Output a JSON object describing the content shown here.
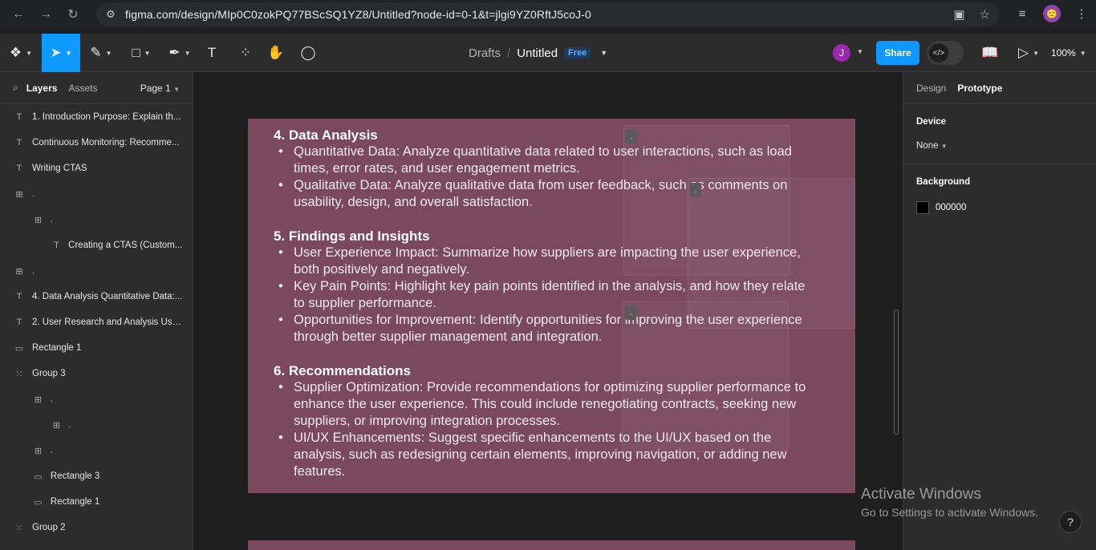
{
  "browser": {
    "url": "figma.com/design/MIp0C0zokPQ77BScSQ1YZ8/Untitled?node-id=0-1&t=jlgi9YZ0RftJ5coJ-0",
    "profile_initial": "🙂"
  },
  "toolbar": {
    "breadcrumb": "Drafts",
    "file_name": "Untitled",
    "plan_badge": "Free",
    "user_initial": "J",
    "share_label": "Share",
    "zoom": "100%"
  },
  "left_panel": {
    "tab_layers": "Layers",
    "tab_assets": "Assets",
    "page": "Page 1",
    "layers": [
      {
        "icon": "T",
        "label": "1. Introduction Purpose: Explain th...",
        "indent": 0,
        "bold": false
      },
      {
        "icon": "T",
        "label": "Continuous Monitoring: Recomme...",
        "indent": 0,
        "bold": false
      },
      {
        "icon": "T",
        "label": "Writing CTAS",
        "indent": 0,
        "bold": false
      },
      {
        "icon": "F",
        "label": ".",
        "indent": 0,
        "bold": false
      },
      {
        "icon": "F",
        "label": ".",
        "indent": 1,
        "bold": false
      },
      {
        "icon": "T",
        "label": "Creating a CTAS (Custom...",
        "indent": 2,
        "bold": false
      },
      {
        "icon": "F",
        "label": ".",
        "indent": 0,
        "bold": false
      },
      {
        "icon": "T",
        "label": "4. Data Analysis Quantitative Data:...",
        "indent": 0,
        "bold": false
      },
      {
        "icon": "T",
        "label": "2. User Research and Analysis Use...",
        "indent": 0,
        "bold": false
      },
      {
        "icon": "R",
        "label": "Rectangle 1",
        "indent": 0,
        "bold": false
      },
      {
        "icon": "G",
        "label": "Group 3",
        "indent": 0,
        "bold": false
      },
      {
        "icon": "F",
        "label": ".",
        "indent": 1,
        "bold": false
      },
      {
        "icon": "F",
        "label": ".",
        "indent": 2,
        "bold": false
      },
      {
        "icon": "F",
        "label": ".",
        "indent": 1,
        "bold": false
      },
      {
        "icon": "R",
        "label": "Rectangle 3",
        "indent": 1,
        "bold": false
      },
      {
        "icon": "R",
        "label": "Rectangle 1",
        "indent": 1,
        "bold": false
      },
      {
        "icon": "G",
        "label": "Group 2",
        "indent": 0,
        "bold": false
      }
    ]
  },
  "canvas": {
    "sections": [
      {
        "heading": "4. Data Analysis",
        "items": [
          "Quantitative Data: Analyze quantitative data related to user interactions, such as load times, error rates, and user engagement metrics.",
          "Qualitative Data: Analyze qualitative data from user feedback, such as comments on usability, design, and overall satisfaction."
        ]
      },
      {
        "heading": "5. Findings and Insights",
        "items": [
          "User Experience Impact: Summarize how suppliers are impacting the user experience, both positively and negatively.",
          "Key Pain Points: Highlight key pain points identified in the analysis, and how they relate to supplier performance.",
          "Opportunities for Improvement: Identify opportunities for improving the user experience through better supplier management and integration."
        ]
      },
      {
        "heading": "6. Recommendations",
        "items": [
          "Supplier Optimization: Provide recommendations for optimizing supplier performance to enhance the user experience. This could include renegotiating contracts, seeking new suppliers, or improving integration processes.",
          "UI/UX Enhancements: Suggest specific enhancements to the UI/UX based on the analysis, such as redesigning certain elements, improving navigation, or adding new features."
        ]
      }
    ],
    "marker": "."
  },
  "right_panel": {
    "tab_design": "Design",
    "tab_prototype": "Prototype",
    "device_label": "Device",
    "device_value": "None",
    "background_label": "Background",
    "background_value": "000000",
    "background_color": "#000000"
  },
  "watermark": {
    "line1": "Activate Windows",
    "line2": "Go to Settings to activate Windows."
  },
  "help_label": "?"
}
